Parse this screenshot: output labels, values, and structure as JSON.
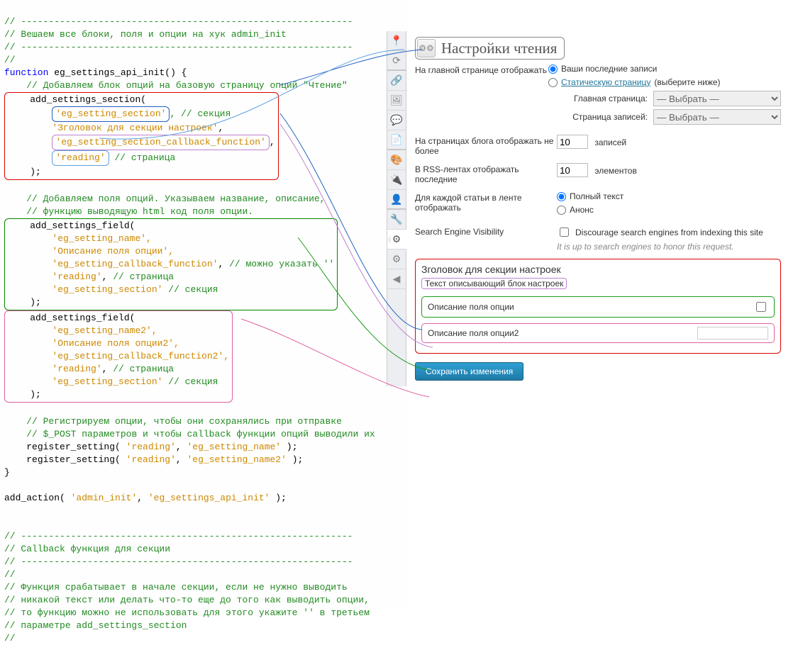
{
  "code": {
    "c1": "// ------------------------------------------------------------",
    "c2": "// Вешаем все блоки, поля и опции на хук admin_init",
    "c3": "// ------------------------------------------------------------",
    "c4": "//",
    "fn_sig": "function eg_settings_api_init() {",
    "add_section_comment": "// Добавляем блок опций на базовую страницу опций \"Чтение\"",
    "ass": "add_settings_section(",
    "ass_arg1": "'eg_setting_section'",
    "ass_arg1_c": ", // секция",
    "ass_arg2": "'Зголовок для секции настроек'",
    "ass_arg2_c": ",",
    "ass_arg3": "'eg_setting_section_callback_function'",
    "ass_arg3_c": ",",
    "ass_arg4": "'reading'",
    "ass_arg4_c": " // страница",
    "close1": ");",
    "fields_comment1": "// Добавляем поля опций. Указываем название, описание,",
    "fields_comment2": "// функцию выводящую html код поля опции.",
    "asf1": "add_settings_field(",
    "asf1_a1": "'eg_setting_name',",
    "asf1_a2": "'Описание поля опции',",
    "asf1_a3": "'eg_setting_callback_function', // можно указать ''",
    "asf1_a4": "'reading', // страница",
    "asf1_a5": "'eg_setting_section' // секция",
    "close2": ");",
    "asf2": "add_settings_field(",
    "asf2_a1": "'eg_setting_name2',",
    "asf2_a2": "'Описание поля опции2',",
    "asf2_a3": "'eg_setting_callback_function2',",
    "asf2_a4": "'reading', // страница",
    "asf2_a5": "'eg_setting_section' // секция",
    "close3": ");",
    "reg_c1": "// Регистрируем опции, чтобы они сохранялись при отправке",
    "reg_c2": "// $_POST параметров и чтобы callback функции опций выводили их",
    "reg1": "register_setting( 'reading', 'eg_setting_name' );",
    "reg2": "register_setting( 'reading', 'eg_setting_name2' );",
    "fn_close": "}",
    "add_action": "add_action( 'admin_init', 'eg_settings_api_init' );",
    "cb_c1": "// ------------------------------------------------------------",
    "cb_c2": "// Callback функция для секции",
    "cb_c3": "// ------------------------------------------------------------",
    "cb_c4": "//",
    "cb_c5": "// Функция срабатывает в начале секции, если не нужно выводить",
    "cb_c6": "// никакой текст или делать что-то еще до того как выводить опции,",
    "cb_c7": "// то функцию можно не использовать для этого укажите '' в третьем",
    "cb_c8": "// параметре add_settings_section",
    "cb_c9": "//"
  },
  "admin": {
    "title": "Настройки чтения",
    "front_page_label": "На главной странице отображать",
    "opt_latest": "Ваши последние записи",
    "opt_static": "Статическую страницу",
    "opt_static_hint": "(выберите ниже)",
    "main_page_label": "Главная страница:",
    "posts_page_label": "Страница записей:",
    "select_placeholder": "— Выбрать —",
    "blog_show_label": "На страницах блога отображать не более",
    "blog_show_value": "10",
    "blog_show_unit": "записей",
    "rss_label": "В RSS-лентах отображать последние",
    "rss_value": "10",
    "rss_unit": "элементов",
    "feed_each_label": "Для каждой статьи в ленте отображать",
    "feed_full": "Полный текст",
    "feed_summary": "Анонс",
    "sev_label": "Search Engine Visibility",
    "sev_opt": "Discourage search engines from indexing this site",
    "sev_note": "It is up to search engines to honor this request.",
    "section_heading": "Зголовок для секции настроек",
    "section_desc": "Текст описывающий блок настроек",
    "opt1_label": "Описание поля опции",
    "opt2_label": "Описание поля опции2",
    "save_btn": "Сохранить изменения"
  }
}
